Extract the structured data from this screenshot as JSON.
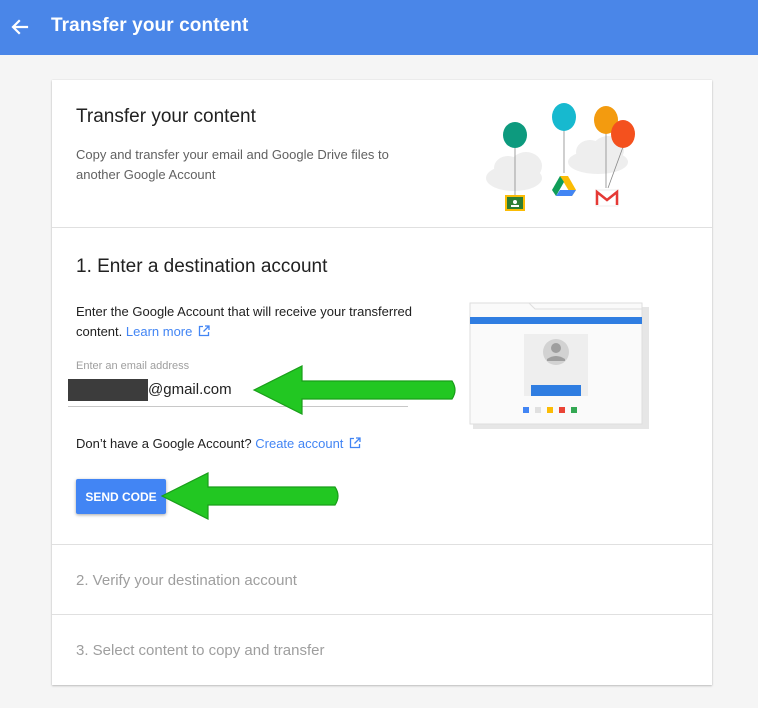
{
  "appbar": {
    "title": "Transfer your content",
    "back_icon": "arrow-back-icon",
    "color": "#4a86e8"
  },
  "intro": {
    "heading": "Transfer your content",
    "description": "Copy and transfer your email and Google Drive files to another Google Account",
    "illustration_icons": [
      "classroom-icon",
      "drive-icon",
      "gmail-icon",
      "balloon-icon",
      "cloud-icon"
    ]
  },
  "step1": {
    "heading": "1. Enter a destination account",
    "description": "Enter the Google Account that will receive your transferred content.",
    "learn_more": "Learn more",
    "field_label": "Enter an email address",
    "email_suffix": "@gmail.com",
    "no_account_text": "Don’t have a Google Account?",
    "create_account": "Create account",
    "send_code": "SEND CODE"
  },
  "step2": {
    "heading": "2. Verify your destination account"
  },
  "step3": {
    "heading": "3. Select content to copy and transfer"
  },
  "colors": {
    "accent": "#4285f4",
    "annotation_arrow": "#22c722"
  }
}
